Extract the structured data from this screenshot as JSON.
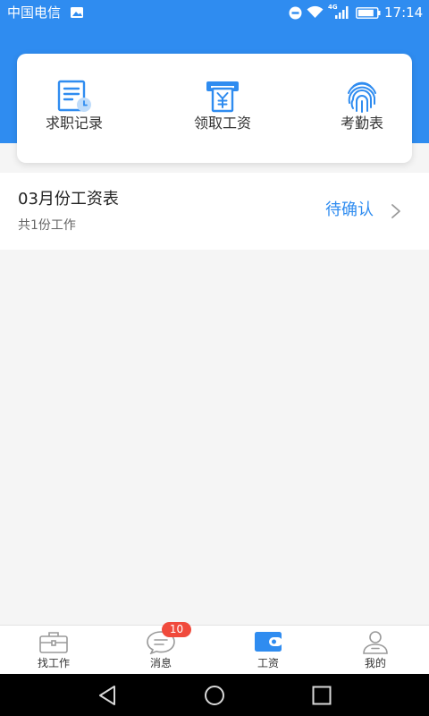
{
  "status_bar": {
    "carrier": "中国电信",
    "network": "4G",
    "time": "17:14",
    "battery_level": 0.85,
    "icons": [
      "gallery-icon",
      "do-not-disturb-icon",
      "wifi-icon",
      "signal-icon",
      "battery-icon"
    ]
  },
  "quick_actions": [
    {
      "label": "求职记录",
      "icon": "job-record-icon"
    },
    {
      "label": "领取工资",
      "icon": "salary-withdraw-icon"
    },
    {
      "label": "考勤表",
      "icon": "fingerprint-icon"
    }
  ],
  "salary_list": [
    {
      "title": "03月份工资表",
      "subtitle": "共1份工作",
      "status": "待确认"
    }
  ],
  "tab_bar": {
    "items": [
      {
        "label": "找工作",
        "icon": "briefcase-icon",
        "active": false
      },
      {
        "label": "消息",
        "icon": "chat-icon",
        "badge": "10",
        "active": false
      },
      {
        "label": "工资",
        "icon": "wallet-icon",
        "active": true
      },
      {
        "label": "我的",
        "icon": "person-icon",
        "active": false
      }
    ]
  },
  "system_nav": {
    "icons": [
      "back-icon",
      "home-icon",
      "recents-icon"
    ]
  },
  "colors": {
    "primary": "#2f8cf0",
    "badge": "#f04a3c",
    "background": "#f5f5f5",
    "text": "#333333",
    "muted": "#666666"
  }
}
